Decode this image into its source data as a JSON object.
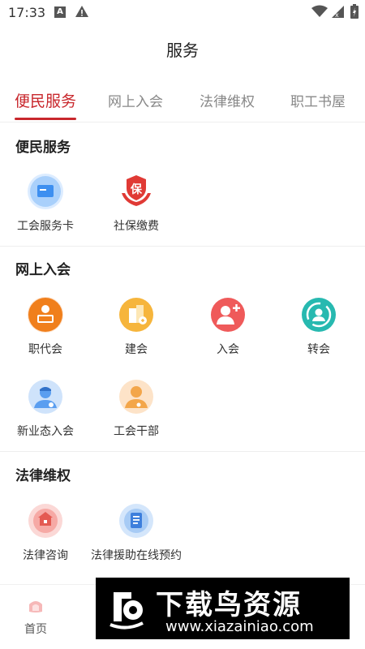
{
  "status_bar": {
    "time": "17:33",
    "a_icon": "A"
  },
  "header": {
    "title": "服务"
  },
  "tabs": [
    {
      "label": "便民服务",
      "active": true
    },
    {
      "label": "网上入会",
      "active": false
    },
    {
      "label": "法律维权",
      "active": false
    },
    {
      "label": "职工书屋",
      "active": false
    }
  ],
  "sections": {
    "convenience": {
      "title": "便民服务",
      "items": [
        {
          "label": "工会服务卡",
          "icon": "card-icon"
        },
        {
          "label": "社保缴费",
          "icon": "insurance-icon",
          "icon_text": "保"
        }
      ]
    },
    "online_join": {
      "title": "网上入会",
      "items": [
        {
          "label": "职代会",
          "icon": "congress-icon"
        },
        {
          "label": "建会",
          "icon": "building-icon"
        },
        {
          "label": "入会",
          "icon": "add-member-icon"
        },
        {
          "label": "转会",
          "icon": "transfer-icon"
        },
        {
          "label": "新业态入会",
          "icon": "new-worker-icon"
        },
        {
          "label": "工会干部",
          "icon": "cadre-icon"
        }
      ]
    },
    "legal": {
      "title": "法律维权",
      "items": [
        {
          "label": "法律咨询",
          "icon": "legal-consult-icon"
        },
        {
          "label": "法律援助在线预约",
          "icon": "legal-aid-icon"
        }
      ]
    }
  },
  "bottom_nav": {
    "home_label": "首页"
  },
  "watermark": {
    "title": "下载鸟资源",
    "url": "www.xiazainiao.com"
  },
  "colors": {
    "accent": "#c8272c",
    "blue": "#4a9bf0",
    "orange": "#f08a24",
    "yellow": "#f6b53c",
    "red": "#ef5a5a",
    "teal": "#27b9b0"
  }
}
